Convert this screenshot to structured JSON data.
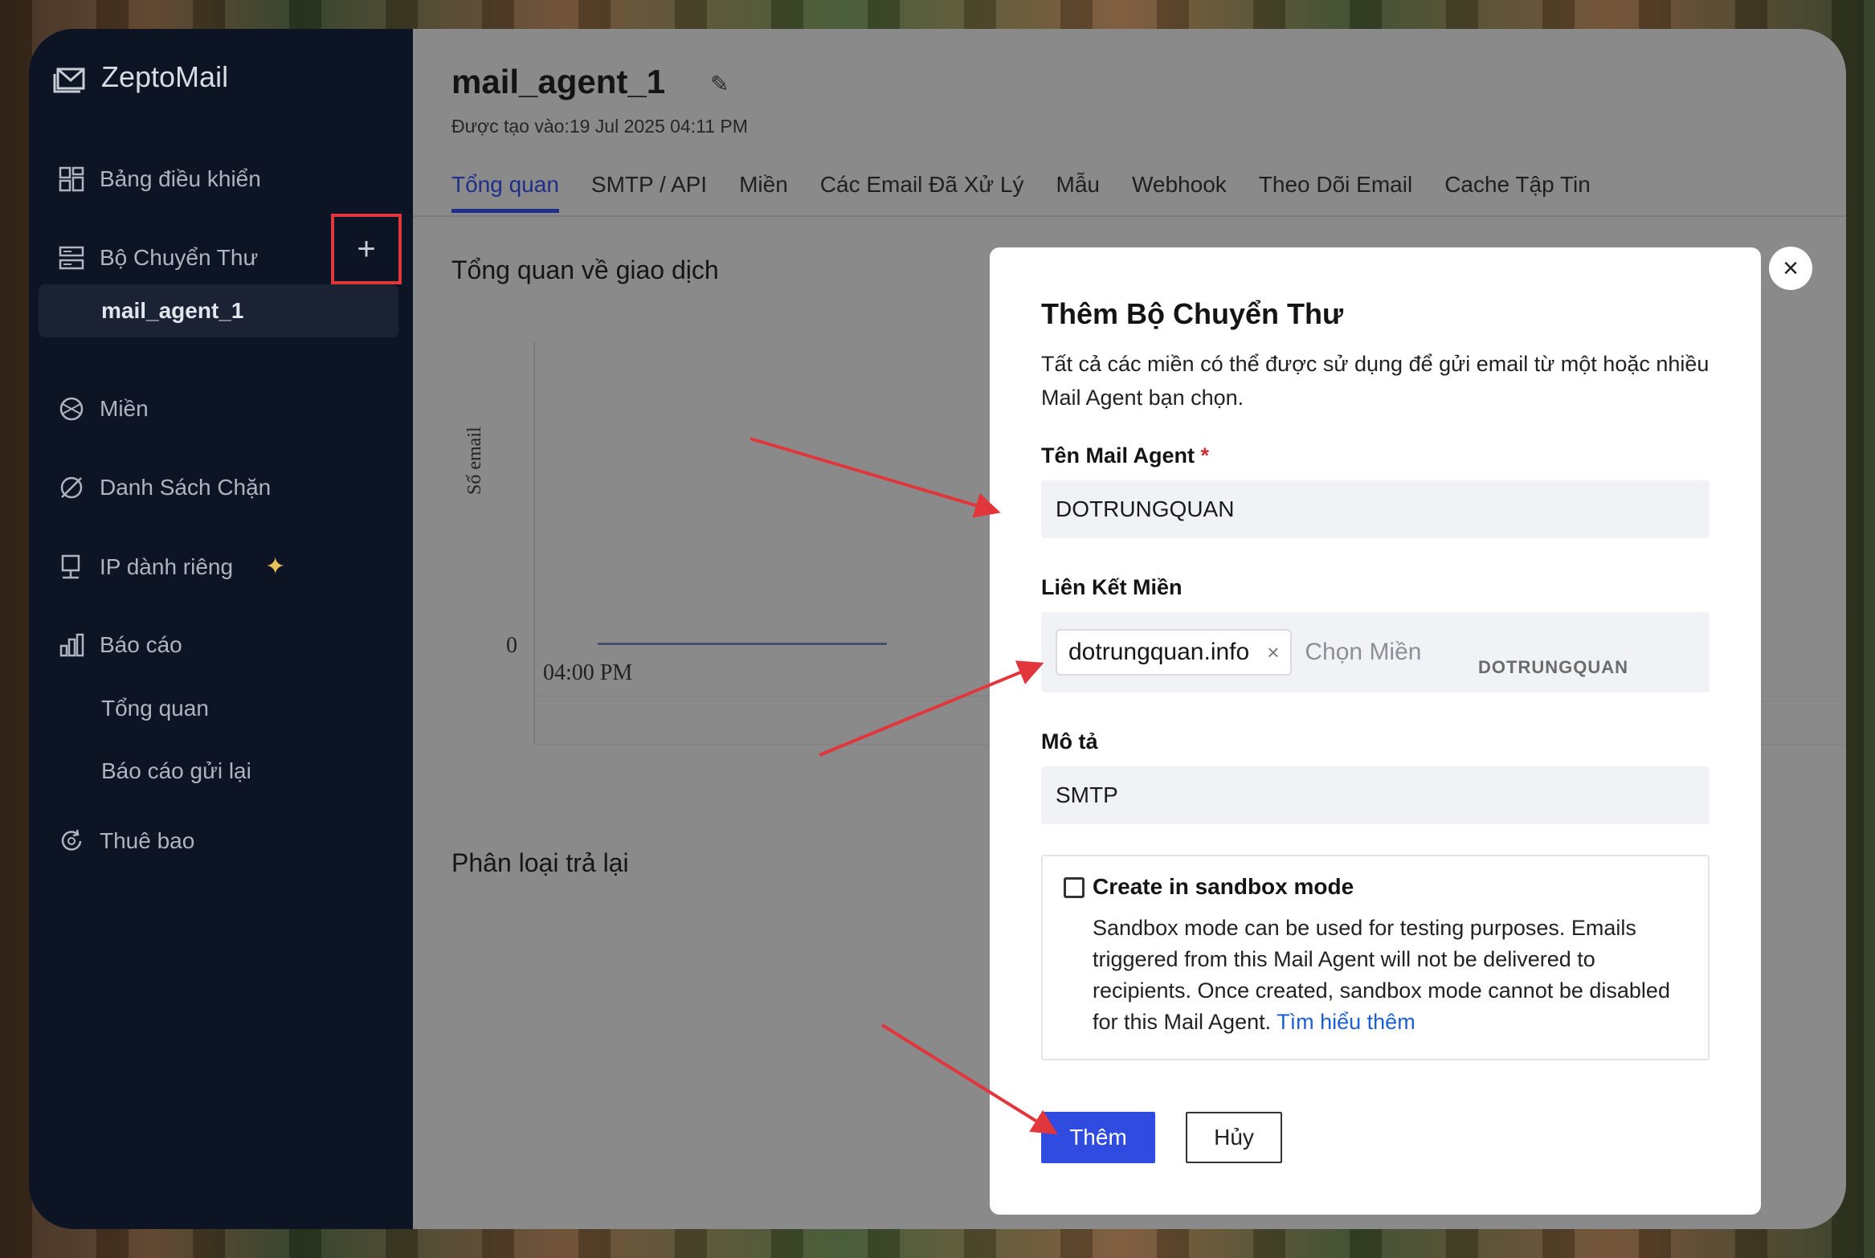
{
  "brand": {
    "name": "ZeptoMail",
    "icon": "mail-logo-icon"
  },
  "sidebar": {
    "items": [
      {
        "label": "Bảng điều khiển",
        "icon": "dashboard-icon"
      },
      {
        "label": "Bộ Chuyển Thư",
        "icon": "server-icon"
      },
      {
        "label": "mail_agent_1"
      },
      {
        "label": "Miền",
        "icon": "globe-icon"
      },
      {
        "label": "Danh Sách Chặn",
        "icon": "block-icon"
      },
      {
        "label": "IP dành riêng",
        "icon": "ip-icon",
        "badge": "✦"
      },
      {
        "label": "Báo cáo",
        "icon": "chart-icon"
      },
      {
        "label": "Tổng quan"
      },
      {
        "label": "Báo cáo gửi lại"
      },
      {
        "label": "Thuê bao",
        "icon": "subscription-icon"
      }
    ],
    "add_button": "+"
  },
  "main": {
    "title": "mail_agent_1",
    "created": "Được tạo vào:19 Jul 2025 04:11 PM",
    "tabs": [
      "Tổng quan",
      "SMTP / API",
      "Miền",
      "Các Email Đã Xử Lý",
      "Mẫu",
      "Webhook",
      "Theo Dõi Email",
      "Cache Tập Tin"
    ],
    "section1": "Tổng quan về giao dịch",
    "section2": "Phân loại trả lại"
  },
  "chart_data": {
    "type": "line",
    "title": "",
    "ylabel": "Số email",
    "xlabel": "",
    "x": [
      "04:00 PM"
    ],
    "y_tick": "0",
    "series": [
      {
        "values": [
          0
        ]
      }
    ]
  },
  "modal": {
    "title": "Thêm Bộ Chuyển Thư",
    "description": "Tất cả các miền có thể được sử dụng để gửi email từ một hoặc nhiều Mail Agent bạn chọn.",
    "name_label": "Tên Mail Agent",
    "required_mark": "*",
    "name_value": "DOTRUNGQUAN",
    "domain_label": "Liên Kết Miền",
    "domain_chip": "dotrungquan.info",
    "chip_remove": "×",
    "domain_placeholder": "Chọn Miền",
    "desc_label": "Mô tả",
    "desc_value": "SMTP",
    "sandbox_title": "Create in sandbox mode",
    "sandbox_text": "Sandbox mode can be used for testing purposes. Emails triggered from this Mail Agent will not be delivered to recipients. Once created, sandbox mode cannot be disabled for this Mail Agent.",
    "learn_more": "Tìm hiểu thêm",
    "submit": "Thêm",
    "cancel": "Hủy",
    "close": "×"
  },
  "watermark": "DOTRUNGQUAN",
  "colors": {
    "primary": "#2f4be0",
    "annotation": "#e0363c",
    "sidebar_bg": "#0d1424"
  }
}
